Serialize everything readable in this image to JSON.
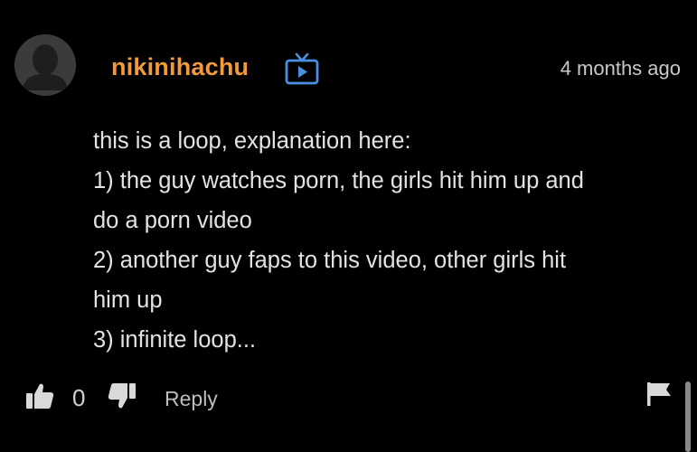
{
  "comment": {
    "username": "nikinihachu",
    "username_color": "#f39a3d",
    "badge_icon": "tv-icon",
    "timestamp": "4 months ago",
    "lines": [
      "this is a loop, explanation here:",
      "1) the guy watches porn, the girls hit him up and",
      "do a porn video",
      "2) another guy faps to this video, other girls hit",
      "him up",
      "3) infinite loop..."
    ]
  },
  "actions": {
    "upvote_icon": "thumbs-up-icon",
    "vote_count": "0",
    "downvote_icon": "thumbs-down-icon",
    "reply_label": "Reply",
    "flag_icon": "flag-icon"
  }
}
